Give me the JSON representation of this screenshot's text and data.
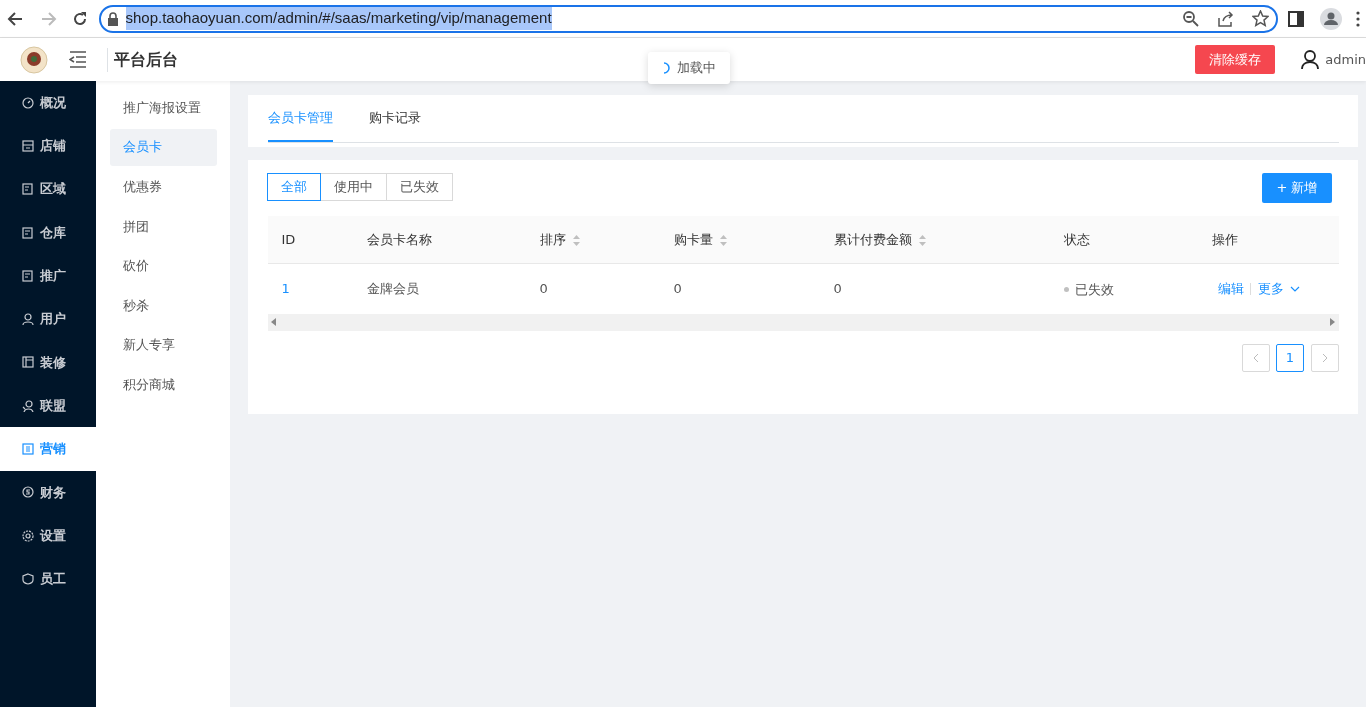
{
  "browser": {
    "url": "shop.taohaoyuan.com/admin/#/saas/marketing/vip/management"
  },
  "header": {
    "title": "平台后台",
    "loading": "加载中",
    "clear_cache": "清除缓存",
    "user": "admin"
  },
  "sidebar": {
    "items": [
      {
        "label": "概况",
        "selected": false
      },
      {
        "label": "店铺",
        "selected": false
      },
      {
        "label": "区域",
        "selected": false
      },
      {
        "label": "仓库",
        "selected": false
      },
      {
        "label": "推广",
        "selected": false
      },
      {
        "label": "用户",
        "selected": false
      },
      {
        "label": "装修",
        "selected": false
      },
      {
        "label": "联盟",
        "selected": false
      },
      {
        "label": "营销",
        "selected": true
      },
      {
        "label": "财务",
        "selected": false
      },
      {
        "label": "设置",
        "selected": false
      },
      {
        "label": "员工",
        "selected": false
      }
    ]
  },
  "subnav": {
    "items": [
      {
        "label": "推广海报设置",
        "selected": false
      },
      {
        "label": "会员卡",
        "selected": true
      },
      {
        "label": "优惠券",
        "selected": false
      },
      {
        "label": "拼团",
        "selected": false
      },
      {
        "label": "砍价",
        "selected": false
      },
      {
        "label": "秒杀",
        "selected": false
      },
      {
        "label": "新人专享",
        "selected": false
      },
      {
        "label": "积分商城",
        "selected": false
      }
    ]
  },
  "tabs": [
    {
      "label": "会员卡管理",
      "selected": true
    },
    {
      "label": "购卡记录",
      "selected": false
    }
  ],
  "filters": [
    {
      "label": "全部",
      "selected": true
    },
    {
      "label": "使用中",
      "selected": false
    },
    {
      "label": "已失效",
      "selected": false
    }
  ],
  "add_button": "+ 新增",
  "table": {
    "columns": [
      {
        "label": "ID",
        "sortable": false
      },
      {
        "label": "会员卡名称",
        "sortable": false
      },
      {
        "label": "排序",
        "sortable": true
      },
      {
        "label": "购卡量",
        "sortable": true
      },
      {
        "label": "累计付费金额",
        "sortable": true
      },
      {
        "label": "状态",
        "sortable": false
      },
      {
        "label": "操作",
        "sortable": false
      }
    ],
    "rows": [
      {
        "id": "1",
        "name": "金牌会员",
        "sort": "0",
        "quantity": "0",
        "amount": "0",
        "status": "已失效",
        "color": "#c0c0c0",
        "edit": "编辑",
        "more": "更多"
      }
    ]
  },
  "pagination": {
    "pages": [
      {
        "label": "1",
        "selected": true
      }
    ]
  }
}
